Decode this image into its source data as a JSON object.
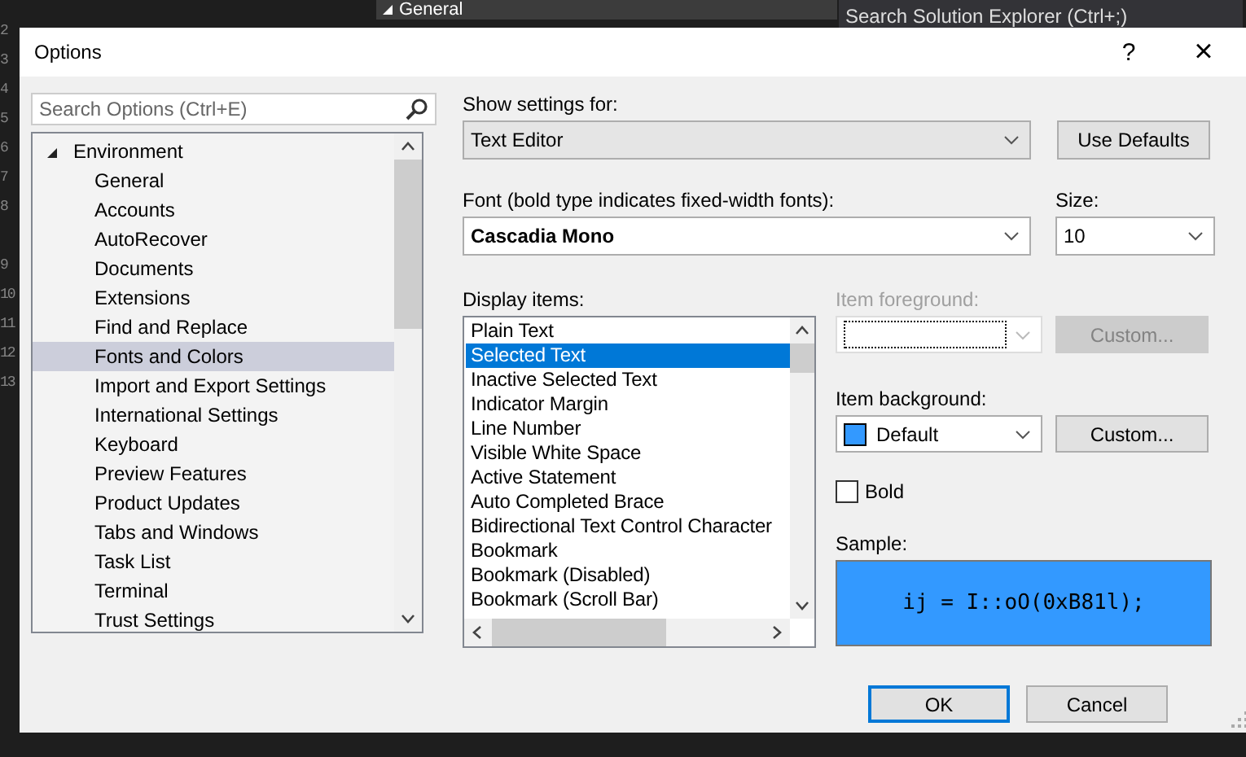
{
  "background": {
    "line_numbers": [
      "2",
      "3",
      "4",
      "5",
      "6",
      "7",
      "8"
    ],
    "line_numbers_lower": [
      "9",
      "10",
      "11",
      "12",
      "13"
    ],
    "panel_header": "General",
    "solution_search": {
      "placeholder": "Search Solution Explorer (Ctrl+;)"
    }
  },
  "window": {
    "title": "Options",
    "help": "?",
    "close": "×"
  },
  "search": {
    "placeholder": "Search Options (Ctrl+E)"
  },
  "tree": [
    {
      "label": "Environment",
      "expanded": true,
      "selected": false,
      "children": [
        {
          "label": "General",
          "selected": false
        },
        {
          "label": "Accounts",
          "selected": false
        },
        {
          "label": "AutoRecover",
          "selected": false
        },
        {
          "label": "Documents",
          "selected": false
        },
        {
          "label": "Extensions",
          "selected": false
        },
        {
          "label": "Find and Replace",
          "selected": false
        },
        {
          "label": "Fonts and Colors",
          "selected": true
        },
        {
          "label": "Import and Export Settings",
          "selected": false
        },
        {
          "label": "International Settings",
          "selected": false
        },
        {
          "label": "Keyboard",
          "selected": false
        },
        {
          "label": "Preview Features",
          "selected": false
        },
        {
          "label": "Product Updates",
          "selected": false
        },
        {
          "label": "Tabs and Windows",
          "selected": false
        },
        {
          "label": "Task List",
          "selected": false
        },
        {
          "label": "Terminal",
          "selected": false
        },
        {
          "label": "Trust Settings",
          "selected": false
        }
      ]
    }
  ],
  "show_settings": {
    "label": "Show settings for:",
    "value": "Text Editor"
  },
  "use_defaults": "Use Defaults",
  "font": {
    "label": "Font (bold type indicates fixed-width fonts):",
    "value": "Cascadia Mono"
  },
  "size": {
    "label": "Size:",
    "value": "10"
  },
  "display_items": {
    "label": "Display items:",
    "items": [
      {
        "label": "Plain Text",
        "selected": false
      },
      {
        "label": "Selected Text",
        "selected": true
      },
      {
        "label": "Inactive Selected Text",
        "selected": false
      },
      {
        "label": "Indicator Margin",
        "selected": false
      },
      {
        "label": "Line Number",
        "selected": false
      },
      {
        "label": "Visible White Space",
        "selected": false
      },
      {
        "label": "Active Statement",
        "selected": false
      },
      {
        "label": "Auto Completed Brace",
        "selected": false
      },
      {
        "label": "Bidirectional Text Control Character",
        "selected": false
      },
      {
        "label": "Bookmark",
        "selected": false
      },
      {
        "label": "Bookmark (Disabled)",
        "selected": false
      },
      {
        "label": "Bookmark (Scroll Bar)",
        "selected": false
      }
    ]
  },
  "item_foreground": {
    "label": "Item foreground:",
    "disabled": true,
    "custom": "Custom..."
  },
  "item_background": {
    "label": "Item background:",
    "value": "Default",
    "color": "#3399ff",
    "disabled": false,
    "custom": "Custom..."
  },
  "bold": {
    "label": "Bold",
    "checked": false
  },
  "sample": {
    "label": "Sample:",
    "text": "ij = I::oO(0xB81l);",
    "color": "#3399ff"
  },
  "buttons": [
    {
      "label": "OK",
      "kind": "default"
    },
    {
      "label": "Cancel",
      "kind": "normal"
    }
  ]
}
